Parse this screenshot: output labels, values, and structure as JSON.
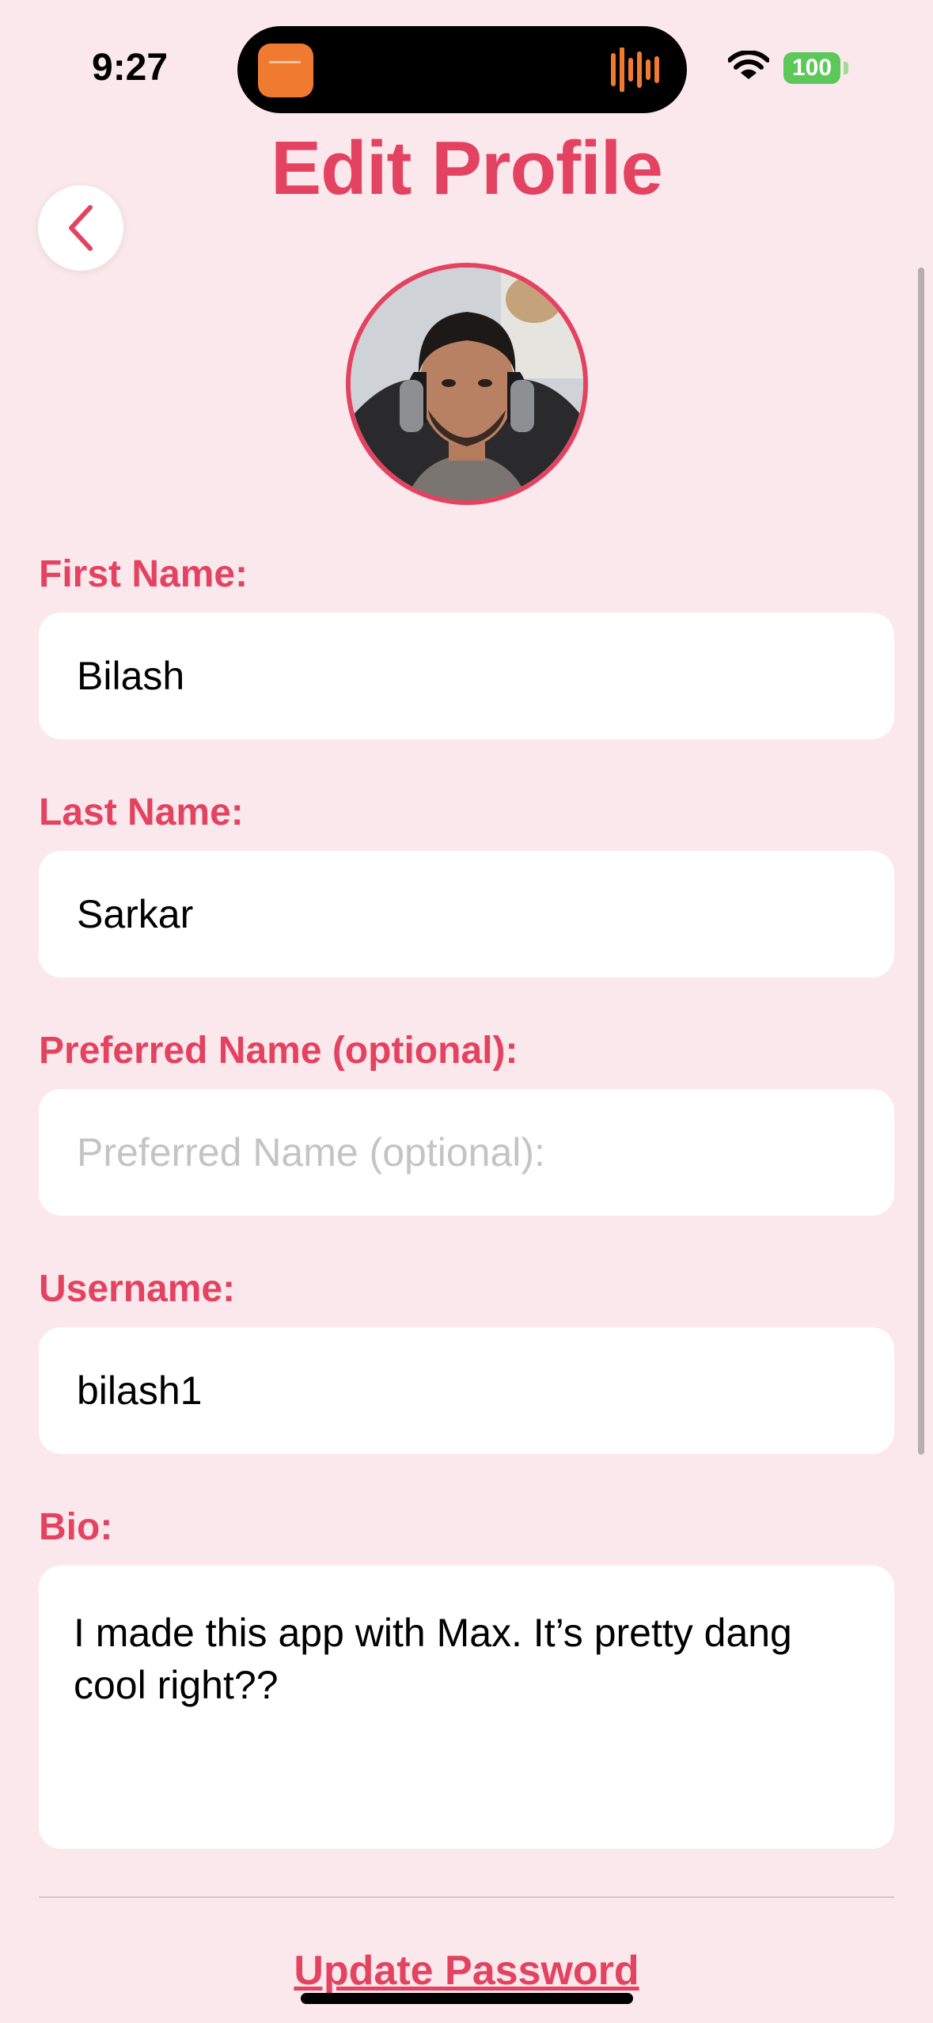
{
  "status_bar": {
    "time": "9:27",
    "battery": "100"
  },
  "header": {
    "title": "Edit Profile"
  },
  "form": {
    "first_name": {
      "label": "First Name:",
      "value": "Bilash"
    },
    "last_name": {
      "label": "Last Name:",
      "value": "Sarkar"
    },
    "preferred_name": {
      "label": "Preferred Name (optional):",
      "value": "",
      "placeholder": "Preferred Name (optional):"
    },
    "username": {
      "label": "Username:",
      "value": "bilash1"
    },
    "bio": {
      "label": "Bio:",
      "value": "I made this app with Max. It’s pretty dang cool right??"
    }
  },
  "actions": {
    "update_password": "Update Password"
  },
  "colors": {
    "accent": "#e34360",
    "background": "#fbe8ec",
    "battery": "#5cc85a",
    "island_app": "#f07a2f"
  },
  "icons": {
    "back": "chevron-left-icon",
    "wifi": "wifi-icon",
    "audio": "audio-waveform-icon"
  }
}
